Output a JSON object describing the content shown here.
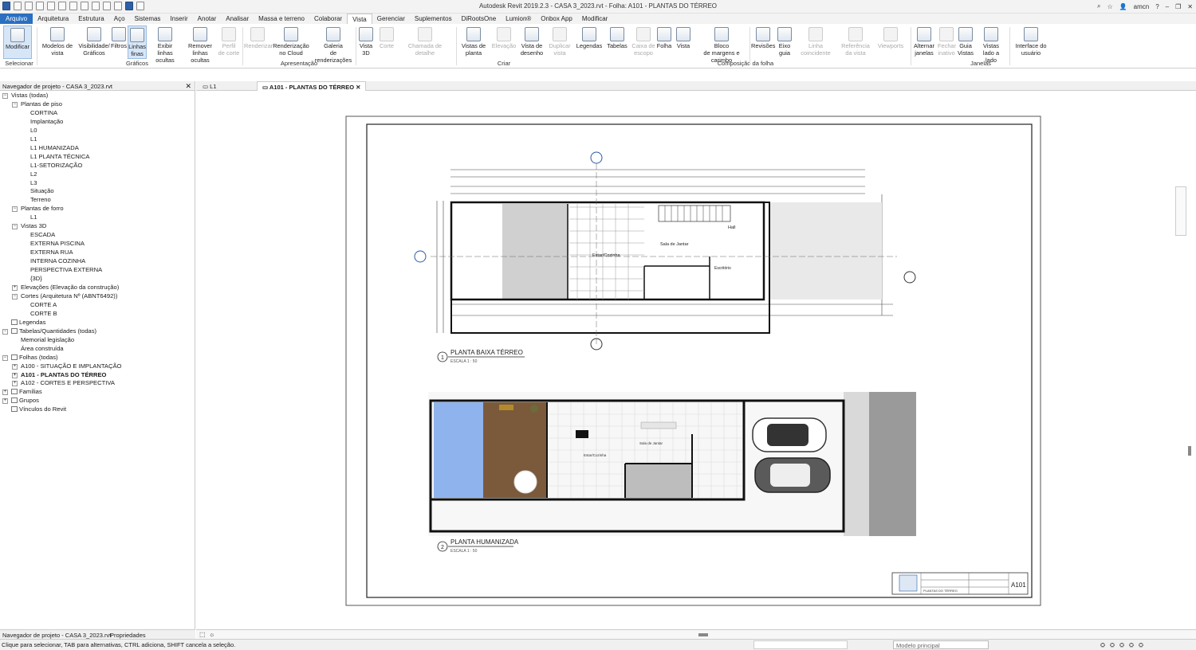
{
  "app": {
    "title": "Autodesk Revit 2019.2.3 - CASA 3_2023.rvt - Folha: A101 - PLANTAS DO TÉRREO",
    "user": "amcn"
  },
  "menu": [
    "Arquivo",
    "Arquitetura",
    "Estrutura",
    "Aço",
    "Sistemas",
    "Inserir",
    "Anotar",
    "Analisar",
    "Massa e terreno",
    "Colaborar",
    "Vista",
    "Gerenciar",
    "Suplementos",
    "DiRootsOne",
    "Lumion®",
    "Onbox App",
    "Modificar"
  ],
  "ribbon": {
    "tools": [
      {
        "l1": "",
        "l2": "Modificar"
      },
      {
        "l1": "Modelos de",
        "l2": "vista"
      },
      {
        "l1": "Visibilidade/",
        "l2": "Gráficos"
      },
      {
        "l1": "",
        "l2": "Filtros"
      },
      {
        "l1": "Linhas",
        "l2": "finas"
      },
      {
        "l1": "Exibir",
        "l2": "linhas ocultas"
      },
      {
        "l1": "Remover",
        "l2": "linhas ocultas"
      },
      {
        "l1": "Perfil",
        "l2": "de corte"
      },
      {
        "l1": "",
        "l2": "Renderizar"
      },
      {
        "l1": "Renderização",
        "l2": "no Cloud"
      },
      {
        "l1": "Galeria",
        "l2": "de renderizações"
      },
      {
        "l1": "Vista",
        "l2": "3D"
      },
      {
        "l1": "",
        "l2": "Corte"
      },
      {
        "l1": "",
        "l2": "Chamada de detalhe"
      },
      {
        "l1": "Vistas de",
        "l2": "planta"
      },
      {
        "l1": "",
        "l2": "Elevação"
      },
      {
        "l1": "Vista de",
        "l2": "desenho"
      },
      {
        "l1": "Duplicar",
        "l2": "vista"
      },
      {
        "l1": "",
        "l2": "Legendas"
      },
      {
        "l1": "",
        "l2": "Tabelas"
      },
      {
        "l1": "Caixa de",
        "l2": "escopo"
      },
      {
        "l1": "",
        "l2": "Folha"
      },
      {
        "l1": "",
        "l2": "Vista"
      },
      {
        "l1": "Bloco",
        "l2": "de margens e carimbo"
      },
      {
        "l1": "",
        "l2": "Revisões"
      },
      {
        "l1": "Eixo",
        "l2": "guia"
      },
      {
        "l1": "",
        "l2": "Linha coincidente"
      },
      {
        "l1": "",
        "l2": "Referência da vista"
      },
      {
        "l1": "",
        "l2": "Viewports"
      },
      {
        "l1": "Alternar",
        "l2": "janelas"
      },
      {
        "l1": "Fechar",
        "l2": "inativo"
      },
      {
        "l1": "Guia",
        "l2": "Vistas"
      },
      {
        "l1": "Vistas",
        "l2": "lado a lado"
      },
      {
        "l1": "Interface do",
        "l2": "usuário"
      }
    ],
    "panels": [
      "Selecionar",
      "Gráficos",
      "Apresentação",
      "Criar",
      "Composição da folha",
      "Janelas"
    ]
  },
  "browser": {
    "title": "Navegador de projeto - CASA 3_2023.rvt",
    "items": [
      {
        "t": "Vistas (todas)",
        "d": 0,
        "e": "-"
      },
      {
        "t": "Plantas de piso",
        "d": 1,
        "e": "-"
      },
      {
        "t": "CORTINA",
        "d": 2
      },
      {
        "t": "Implantação",
        "d": 2
      },
      {
        "t": "L0",
        "d": 2
      },
      {
        "t": "L1",
        "d": 2
      },
      {
        "t": "L1 HUMANIZADA",
        "d": 2
      },
      {
        "t": "L1 PLANTA TÉCNICA",
        "d": 2
      },
      {
        "t": "L1-SETORIZAÇÃO",
        "d": 2
      },
      {
        "t": "L2",
        "d": 2
      },
      {
        "t": "L3",
        "d": 2
      },
      {
        "t": "Situação",
        "d": 2
      },
      {
        "t": "Terreno",
        "d": 2
      },
      {
        "t": "Plantas de forro",
        "d": 1,
        "e": "-"
      },
      {
        "t": "L1",
        "d": 2
      },
      {
        "t": "Vistas 3D",
        "d": 1,
        "e": "-"
      },
      {
        "t": "ESCADA",
        "d": 2
      },
      {
        "t": "EXTERNA PISCINA",
        "d": 2
      },
      {
        "t": "EXTERNA RUA",
        "d": 2
      },
      {
        "t": "INTERNA COZINHA",
        "d": 2
      },
      {
        "t": "PERSPECTIVA EXTERNA",
        "d": 2
      },
      {
        "t": "{3D}",
        "d": 2
      },
      {
        "t": "Elevações (Elevação da construção)",
        "d": 1,
        "e": "+"
      },
      {
        "t": "Cortes (Arquitetura Nº (ABNT6492))",
        "d": 1,
        "e": "-"
      },
      {
        "t": "CORTE A",
        "d": 2
      },
      {
        "t": "CORTE B",
        "d": 2
      },
      {
        "t": "Legendas",
        "d": 0,
        "e": "",
        "i": 1
      },
      {
        "t": "Tabelas/Quantidades (todas)",
        "d": 0,
        "e": "-",
        "i": 1
      },
      {
        "t": "Memorial legislação",
        "d": 1
      },
      {
        "t": "Área construída",
        "d": 1
      },
      {
        "t": "Folhas (todas)",
        "d": 0,
        "e": "-",
        "i": 1
      },
      {
        "t": "A100 - SITUAÇÃO E IMPLANTAÇÃO",
        "d": 1,
        "e": "+"
      },
      {
        "t": "A101 - PLANTAS DO TÉRREO",
        "d": 1,
        "e": "+",
        "b": 1
      },
      {
        "t": "A102 - CORTES E PERSPECTIVA",
        "d": 1,
        "e": "+"
      },
      {
        "t": "Famílias",
        "d": 0,
        "e": "+",
        "i": 1
      },
      {
        "t": "Grupos",
        "d": 0,
        "e": "+",
        "i": 1
      },
      {
        "t": "Vínculos do Revit",
        "d": 0,
        "e": "",
        "i": 1
      }
    ]
  },
  "tabs": {
    "t1": "L1",
    "t2": "A101 - PLANTAS DO TÉRREO"
  },
  "sheet": {
    "v1_num": "1",
    "v1_title": "PLANTA BAIXA TÉRREO",
    "v1_scale": "ESCALA 1 : 50",
    "v2_num": "2",
    "v2_title": "PLANTA HUMANIZADA",
    "v2_scale": "ESCALA 1 : 50",
    "room1": "Estar/Cozinha",
    "room2": "Sala de Jantar",
    "room3": "Hall",
    "room4": "Escritório",
    "room5": "Estar/Cozinha",
    "room6": "Sala de Jantar",
    "sheet_no": "A101",
    "sheet_name": "PLANTAS DO TÉRREO"
  },
  "bottom": {
    "tab1": "Navegador de projeto - CASA 3_2023.rvt",
    "tab2": "Propriedades"
  },
  "status": {
    "hint": "Clique para selecionar, TAB para alternativas, CTRL adiciona, SHIFT cancela a seleção.",
    "model": "Modelo principal"
  }
}
